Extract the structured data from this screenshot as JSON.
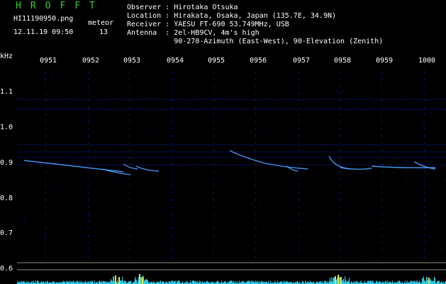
{
  "header": {
    "brand": "HROFFT",
    "filename": "HI11190950.png",
    "datetime": "12.11.19 09:50",
    "meteor_label": "meteor",
    "meteor_count": "13",
    "observer_line": "Observer : Hirotaka Otsuka",
    "location_line": "Location : Hirakata, Osaka, Japan (135.7E, 34.9N)",
    "receiver_line": "Receiver : YAESU FT-690 53.749MHz, USB",
    "antenna_line": "Antenna  : 2el-HB9CV, 4m's high",
    "antenna_line2": "           90-270-Azimuth (East-West), 90-Elevation (Zenith)"
  },
  "axes": {
    "unit": "kHz",
    "time_ticks": [
      "0951",
      "0952",
      "0953",
      "0954",
      "0955",
      "0956",
      "0957",
      "0958",
      "0959",
      "1000"
    ],
    "freq_ticks": [
      "1.1",
      "1.0",
      "0.9",
      "0.8",
      "0.7",
      "0.6"
    ]
  },
  "colors": {
    "brand": "#35d02a",
    "background": "#000000",
    "noise": "#0b1e8c",
    "echo": "#4aa0ff",
    "histogram": "#29c8e6",
    "highlight": "#e6e040"
  }
}
